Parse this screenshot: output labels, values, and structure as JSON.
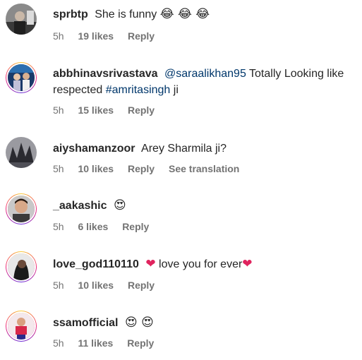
{
  "comments": [
    {
      "username": "sprbtp",
      "text": "She is funny",
      "emoji": "😂 😂 😂",
      "time": "5h",
      "likes": "19 likes",
      "reply": "Reply"
    },
    {
      "username": "abbhinavsrivastava",
      "mention": "@saraalikhan95",
      "text_mid": "Totally Looking like respected",
      "hashtag": "#amritasingh",
      "text_end": "ji",
      "time": "5h",
      "likes": "15 likes",
      "reply": "Reply"
    },
    {
      "username": "aiyshamanzoor",
      "text": "Arey Sharmila ji?",
      "time": "5h",
      "likes": "10 likes",
      "reply": "Reply",
      "translate": "See translation"
    },
    {
      "username": "_aakashic",
      "emoji": "😍",
      "time": "5h",
      "likes": "6 likes",
      "reply": "Reply"
    },
    {
      "username": "love_god110110",
      "heart1": "❤",
      "text": "love you for ever",
      "heart2": "❤",
      "time": "5h",
      "likes": "10 likes",
      "reply": "Reply"
    },
    {
      "username": "ssamofficial",
      "emoji": "😍 😍",
      "time": "5h",
      "likes": "11 likes",
      "reply": "Reply"
    }
  ]
}
